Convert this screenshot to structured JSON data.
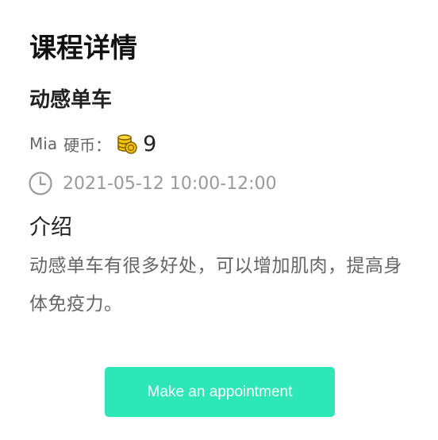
{
  "page": {
    "title": "课程详情"
  },
  "course": {
    "name": "动感单车",
    "coach": "Mia",
    "coin_label": "硬币",
    "coin_separator": "：",
    "coin_count": "9",
    "time": "2021-05-12 10:00-12:00"
  },
  "intro": {
    "title": "介绍",
    "text": "动感单车有很多好处，可以增加肌肉，提高身体免疫力。"
  },
  "actions": {
    "appointment_label": "Make an appointment"
  },
  "colors": {
    "accent": "#2de8b6",
    "coin": "#f5c400",
    "muted_text": "#9a9a9a"
  },
  "icons": {
    "coin": "coin-stack-icon",
    "time": "clock-icon"
  }
}
